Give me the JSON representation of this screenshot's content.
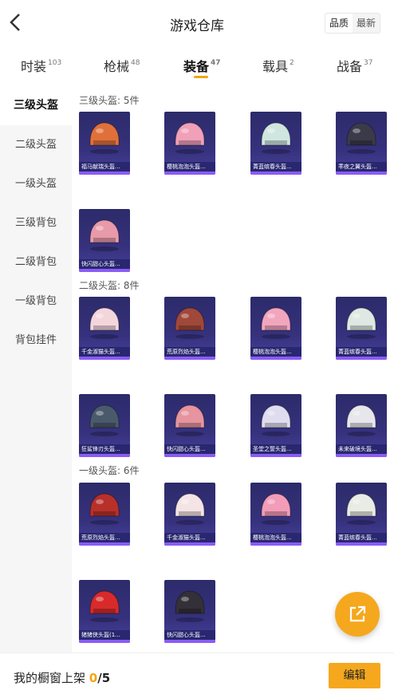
{
  "header": {
    "title": "游戏仓库",
    "sort_options": [
      "品质",
      "最新"
    ],
    "sort_selected": "品质"
  },
  "tabs": [
    {
      "label": "时装",
      "count": "103"
    },
    {
      "label": "枪械",
      "count": "48"
    },
    {
      "label": "装备",
      "count": "47",
      "active": true
    },
    {
      "label": "载具",
      "count": "2"
    },
    {
      "label": "战备",
      "count": "37"
    }
  ],
  "sidebar": {
    "items": [
      "三级头盔",
      "二级头盔",
      "一级头盔",
      "三级背包",
      "二级背包",
      "一级背包",
      "背包挂件"
    ],
    "active": "三级头盔"
  },
  "sections": [
    {
      "title": "三级头盔: 5件",
      "items": [
        {
          "name": "福马献瑞头盔...",
          "icon": "helmet-horse-icon",
          "color": "#e0703a"
        },
        {
          "name": "樱桃泡泡头盔...",
          "icon": "helmet-pig-icon",
          "color": "#f0a0b8"
        },
        {
          "name": "菁蓝缤春头盔...",
          "icon": "helmet-crown-icon",
          "color": "#cfe6e0"
        },
        {
          "name": "乖夜之翼头盔...",
          "icon": "helmet-wing-icon",
          "color": "#3a3a48"
        },
        {
          "name": "快闪甜心头盔...",
          "icon": "helmet-pink-icon",
          "color": "#e89aaa"
        }
      ]
    },
    {
      "title": "二级头盔: 8件",
      "items": [
        {
          "name": "千金淑猫头盔...",
          "icon": "helmet-cat-icon",
          "color": "#f3d6dc"
        },
        {
          "name": "荒原烈焰头盔...",
          "icon": "helmet-flame-icon",
          "color": "#a0483a"
        },
        {
          "name": "樱桃泡泡头盔...",
          "icon": "helmet-pig-icon",
          "color": "#f2a6be"
        },
        {
          "name": "菁蓝缤春头盔...",
          "icon": "helmet-floral-icon",
          "color": "#dfe8e2"
        },
        {
          "name": "狂鲨锋刃头盔...",
          "icon": "helmet-shark-icon",
          "color": "#4a5a6a"
        },
        {
          "name": "快闪甜心头盔...",
          "icon": "helmet-pink-icon",
          "color": "#e6949f"
        },
        {
          "name": "圣堂之誓头盔...",
          "icon": "helmet-wing-icon",
          "color": "#e0dcf0"
        },
        {
          "name": "未来破境头盔...",
          "icon": "helmet-white-icon",
          "color": "#e6e6ec"
        }
      ]
    },
    {
      "title": "一级头盔: 6件",
      "items": [
        {
          "name": "荒原烈焰头盔...",
          "icon": "helmet-flame-icon",
          "color": "#b8302a"
        },
        {
          "name": "千金淑猫头盔...",
          "icon": "helmet-cat-icon",
          "color": "#f4e4e6"
        },
        {
          "name": "樱桃泡泡头盔...",
          "icon": "helmet-pink-icon",
          "color": "#f39cb8"
        },
        {
          "name": "菁蓝缤春头盔...",
          "icon": "helmet-floral-icon",
          "color": "#e8ece4"
        },
        {
          "name": "猪猪侠头盔(1...",
          "icon": "helmet-pig-icon",
          "color": "#d82a2a"
        },
        {
          "name": "快闪甜心头盔...",
          "icon": "helmet-pink-icon",
          "color": "#333038"
        }
      ]
    }
  ],
  "bottom": {
    "showcase_label": "我的橱窗上架",
    "showcase_count": "0",
    "showcase_total": "/5",
    "edit_label": "编辑"
  }
}
